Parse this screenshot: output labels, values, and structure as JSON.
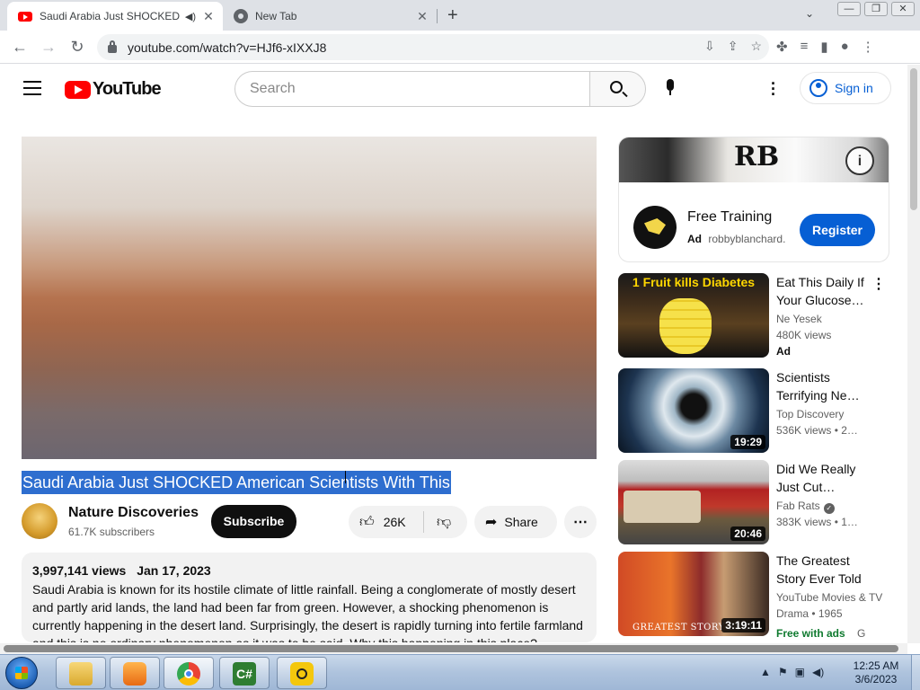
{
  "browser": {
    "tabs": [
      {
        "title": "Saudi Arabia Just SHOCKED",
        "active": true,
        "audio": true
      },
      {
        "title": "New Tab",
        "active": false
      }
    ],
    "url": "youtube.com/watch?v=HJf6-xIXXJ8",
    "new_tab_glyph": "+",
    "close_glyph": "✕",
    "window_buttons": [
      "—",
      "❐",
      "✕"
    ]
  },
  "youtube_header": {
    "logo_text": "YouTube",
    "search_placeholder": "Search",
    "signin_label": "Sign in"
  },
  "video": {
    "title": "Saudi Arabia Just SHOCKED American Scientists With This",
    "channel": {
      "name": "Nature Discoveries",
      "subscribers": "61.7K subscribers"
    },
    "subscribe_label": "Subscribe",
    "likes": "26K",
    "share_label": "Share",
    "description": {
      "views": "3,997,141 views",
      "date": "Jan 17, 2023",
      "text": "Saudi Arabia is known for its hostile climate of little rainfall. Being a conglomerate of mostly desert and partly arid lands, the land had been far from green. However, a shocking phenomenon is currently happening in the desert land. Surprisingly, the desert is rapidly turning into fertile farmland and this is no ordinary phenomenon as it was to be said. Why this happening in this place?"
    }
  },
  "ad": {
    "logo_text": "RB",
    "title": "Free Training",
    "label": "Ad",
    "advertiser": "robbyblanchard.",
    "cta": "Register"
  },
  "recommendations": [
    {
      "thumb_caption": "1 Fruit kills Diabetes",
      "title": "Eat This Daily If Your Glucose…",
      "channel": "Ne Yesek",
      "views": "480K views",
      "badge": "Ad",
      "duration": ""
    },
    {
      "title": "Scientists Terrifying Ne…",
      "channel": "Top Discovery",
      "views": "536K views  • 2…",
      "duration": "19:29"
    },
    {
      "title": "Did We Really Just Cut…",
      "channel": "Fab Rats",
      "verified": true,
      "views": "383K views  • 1…",
      "duration": "20:46"
    },
    {
      "thumb_caption": "GREATEST STORY EVER",
      "title": "The Greatest Story Ever Told",
      "channel": "YouTube Movies & TV",
      "meta": "Drama • 1965",
      "duration": "3:19:11",
      "free_label": "Free with ads",
      "rating": "G"
    }
  ],
  "taskbar": {
    "time": "12:25 AM",
    "date": "3/6/2023",
    "cs_label": "C#"
  }
}
